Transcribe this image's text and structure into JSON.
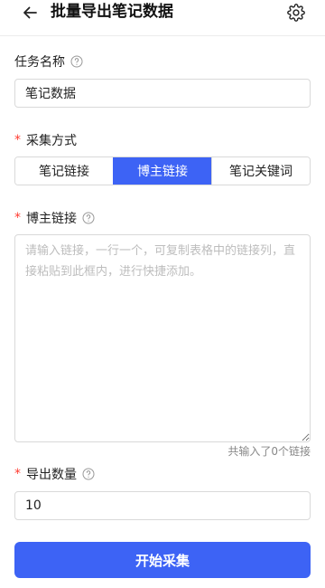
{
  "header": {
    "title": "批量导出笔记数据",
    "back_icon": "arrow-left-icon",
    "settings_icon": "gear-icon"
  },
  "task_name": {
    "label": "任务名称",
    "value": "笔记数据"
  },
  "collect_method": {
    "required_mark": "*",
    "label": "采集方式",
    "options": [
      "笔记链接",
      "博主链接",
      "笔记关键词"
    ],
    "selected": "博主链接"
  },
  "blogger_links": {
    "required_mark": "*",
    "label": "博主链接",
    "placeholder": "请输入链接，一行一个，可复制表格中的链接列，直接粘贴到此框内，进行快捷添加。",
    "counter": "共输入了0个链接"
  },
  "export_count": {
    "required_mark": "*",
    "label": "导出数量",
    "value": "10"
  },
  "submit": {
    "label": "开始采集"
  },
  "colors": {
    "accent": "#3d63f5",
    "required": "#ff3b30"
  }
}
